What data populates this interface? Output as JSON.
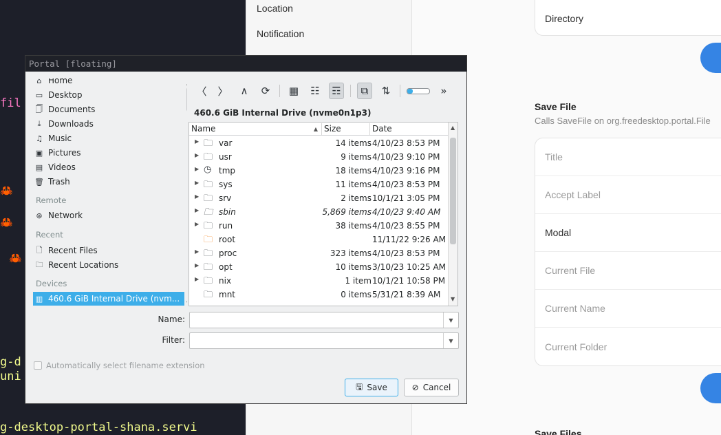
{
  "terminal": {
    "lines": [
      {
        "text": "fil",
        "color": "#ff79c6"
      },
      {
        "text": "g-d",
        "color": "#f1fa8c"
      },
      {
        "text": "uni",
        "color": "#f1fa8c"
      },
      {
        "text": "g-desktop-portal-shana.servi",
        "color": "#f1fa8c"
      }
    ],
    "crab": "🦀"
  },
  "settings_nav": {
    "items": [
      "Location",
      "Notification"
    ]
  },
  "right_panel": {
    "top_card_label": "Directory",
    "save_file": {
      "title": "Save File",
      "subtitle": "Calls SaveFile on org.freedesktop.portal.File",
      "rows": [
        "Title",
        "Accept Label",
        "Modal",
        "Current File",
        "Current Name",
        "Current Folder"
      ]
    },
    "next_section_title": "Save Files",
    "accent_color": "#3584e4"
  },
  "dialog": {
    "title": "Portal [floating]",
    "places": {
      "items_top": [
        {
          "label": "Home",
          "icon": "home-icon",
          "glyph": "⌂"
        },
        {
          "label": "Desktop",
          "icon": "desktop-icon",
          "glyph": "▭"
        },
        {
          "label": "Documents",
          "icon": "documents-icon",
          "glyph": "🗍"
        },
        {
          "label": "Downloads",
          "icon": "downloads-icon",
          "glyph": "⤓"
        },
        {
          "label": "Music",
          "icon": "music-icon",
          "glyph": "♫"
        },
        {
          "label": "Pictures",
          "icon": "pictures-icon",
          "glyph": "▣"
        },
        {
          "label": "Videos",
          "icon": "videos-icon",
          "glyph": "▤"
        },
        {
          "label": "Trash",
          "icon": "trash-icon",
          "glyph": "🗑"
        }
      ],
      "remote_header": "Remote",
      "remote_items": [
        {
          "label": "Network",
          "icon": "network-icon",
          "glyph": "⊛"
        }
      ],
      "recent_header": "Recent",
      "recent_items": [
        {
          "label": "Recent Files",
          "icon": "recent-files-icon",
          "glyph": "🗋"
        },
        {
          "label": "Recent Locations",
          "icon": "recent-locations-icon",
          "glyph": "🗀"
        }
      ],
      "devices_header": "Devices",
      "device_items": [
        {
          "label": "460.6 GiB Internal Drive (nvm...",
          "icon": "drive-icon",
          "glyph": "▥"
        }
      ]
    },
    "toolbar": {
      "back": "〈",
      "forward": "〉",
      "up": "∧",
      "reload": "⟳",
      "icons_view": "▦",
      "compact_view": "☷",
      "details_view": "☶",
      "preview": "⧉",
      "sort": "⇅",
      "more": "»",
      "zoom_level": 0.25
    },
    "location_label": "460.6 GiB Internal Drive (nvme0n1p3)",
    "columns": {
      "name": "Name",
      "size": "Size",
      "date": "Date"
    },
    "files": [
      {
        "name": "var",
        "size": "14 items",
        "date": "4/10/23 8:53 PM",
        "glyph": "🗀",
        "expandable": true
      },
      {
        "name": "usr",
        "size": "9 items",
        "date": "4/10/23 9:10 PM",
        "glyph": "🗀",
        "expandable": true
      },
      {
        "name": "tmp",
        "size": "18 items",
        "date": "4/10/23 9:16 PM",
        "glyph": "◷",
        "expandable": true
      },
      {
        "name": "sys",
        "size": "11 items",
        "date": "4/10/23 8:53 PM",
        "glyph": "🗀",
        "expandable": true
      },
      {
        "name": "srv",
        "size": "2 items",
        "date": "10/1/21 3:05 PM",
        "glyph": "🗀",
        "expandable": true
      },
      {
        "name": "sbin",
        "size": "5,869 items",
        "date": "4/10/23 9:40 AM",
        "glyph": "🗀",
        "expandable": true,
        "italic": true
      },
      {
        "name": "run",
        "size": "38 items",
        "date": "4/10/23 8:55 PM",
        "glyph": "🗀",
        "expandable": true
      },
      {
        "name": "root",
        "size": "",
        "date": "11/11/22 9:26 AM",
        "glyph": "🗀",
        "expandable": false,
        "color": "#f67400"
      },
      {
        "name": "proc",
        "size": "323 items",
        "date": "4/10/23 8:53 PM",
        "glyph": "🗀",
        "expandable": true
      },
      {
        "name": "opt",
        "size": "10 items",
        "date": "3/10/23 10:25 AM",
        "glyph": "🗀",
        "expandable": true
      },
      {
        "name": "nix",
        "size": "1 item",
        "date": "10/1/21 10:58 PM",
        "glyph": "🗀",
        "expandable": true
      },
      {
        "name": "mnt",
        "size": "0 items",
        "date": "5/31/21 8:39 AM",
        "glyph": "🗀",
        "expandable": false
      }
    ],
    "name_label": "Name:",
    "name_value": "",
    "filter_label": "Filter:",
    "filter_value": "",
    "auto_extension_label": "Automatically select filename extension",
    "save_label": "Save",
    "cancel_label": "Cancel",
    "highlight_color": "#3daee9"
  }
}
